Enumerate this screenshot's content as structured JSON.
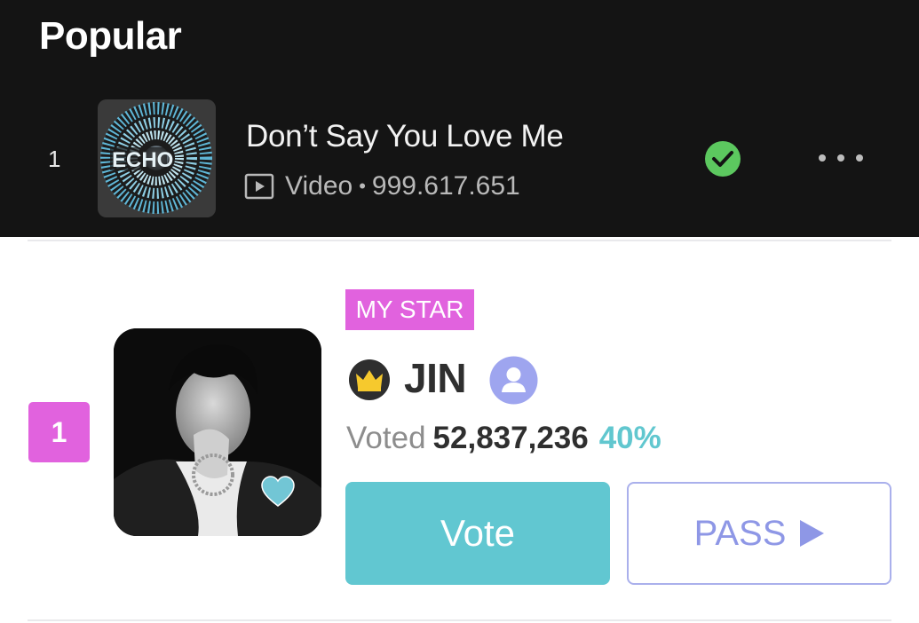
{
  "popular": {
    "section_title": "Popular",
    "track": {
      "rank": "1",
      "cover_text": "ECHO",
      "title": "Don’t Say You Love Me",
      "media_type": "Video",
      "separator": "•",
      "views": "999.617.651",
      "status_icon": "check-circle-icon",
      "menu_icon": "more-horizontal-icon"
    }
  },
  "ranking": {
    "rank": "1",
    "tag": "MY STAR",
    "artist_name": "JIN",
    "vote_label": "Voted",
    "vote_count": "52,837,236",
    "vote_percent": "40%",
    "vote_button": "Vote",
    "pass_button": "PASS",
    "icons": [
      "crown-icon",
      "profile-icon",
      "heart-icon",
      "play-triangle-icon"
    ]
  },
  "colors": {
    "dark_background": "#141414",
    "accent_pink": "#e162de",
    "accent_teal": "#61c7d1",
    "accent_lavender": "#8e97e6",
    "check_green": "#5cc85f"
  }
}
